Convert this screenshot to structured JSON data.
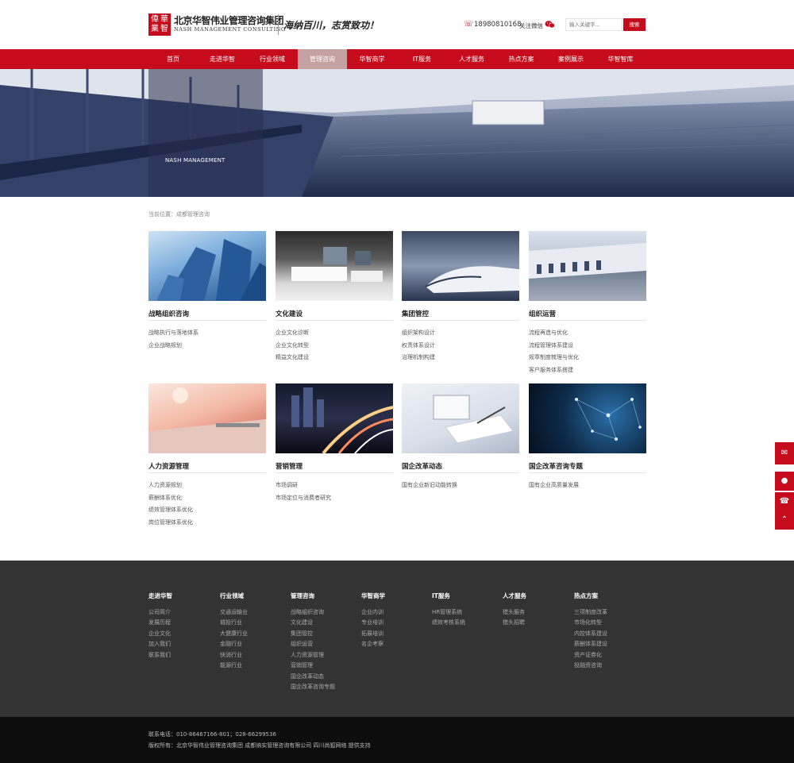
{
  "header": {
    "seal_chars": [
      "偉",
      "華",
      "業",
      "智"
    ],
    "logo_cn": "北京华智伟业管理咨询集团",
    "logo_en": "NASH MANAGEMENT CONSULTING",
    "slogan": "海纳百川，志赏致功！",
    "phone": "18980810168",
    "follow_label": "关注微信",
    "search_placeholder": "输入关键字...",
    "search_button": "搜索",
    "accent_color": "#c60c1c"
  },
  "nav": {
    "items": [
      "首页",
      "走进华智",
      "行业领域",
      "管理咨询",
      "华智商学",
      "IT服务",
      "人才服务",
      "热点方案",
      "案例展示",
      "华智智库"
    ],
    "active_index": 3
  },
  "banner": {
    "caption": "NASH MANAGEMENT"
  },
  "breadcrumb": "当前位置：成都管理咨询",
  "cards": [
    {
      "title": "战略组织咨询",
      "image": "glass-skyscraper-photo",
      "links": [
        "战略执行与落地体系",
        "企业战略规划"
      ]
    },
    {
      "title": "文化建设",
      "image": "modern-office-photo",
      "links": [
        "企业文化诊断",
        "企业文化转型",
        "精益文化建设"
      ]
    },
    {
      "title": "集团管控",
      "image": "high-speed-train-photo",
      "links": [
        "组织架构设计",
        "权责体系设计",
        "治理机制构建"
      ]
    },
    {
      "title": "组织运营",
      "image": "logistics-warehouse-photo",
      "links": [
        "流程再造与优化",
        "流程管理体系建设",
        "规章制度梳理与优化",
        "客户服务体系搭建"
      ]
    },
    {
      "title": "人力资源管理",
      "image": "desk-at-sunset-photo",
      "links": [
        "人力资源规划",
        "薪酬体系优化",
        "绩效管理体系优化",
        "岗位管理体系优化"
      ]
    },
    {
      "title": "营销管理",
      "image": "city-night-traffic-photo",
      "links": [
        "市场调研",
        "市场定位与消费者研究"
      ]
    },
    {
      "title": "国企改革动态",
      "image": "business-documents-photo",
      "links": [
        "国有企业新旧动能转换"
      ]
    },
    {
      "title": "国企改革咨询专题",
      "image": "network-nodes-photo",
      "links": [
        "国有企业高质量发展"
      ]
    }
  ],
  "footer": {
    "columns": [
      {
        "title": "走进华智",
        "items": [
          "公司简介",
          "发展历程",
          "企业文化",
          "加入我们",
          "联系我们"
        ]
      },
      {
        "title": "行业领域",
        "items": [
          "交通运输业",
          "城投行业",
          "大健康行业",
          "金融行业",
          "快消行业",
          "能源行业"
        ]
      },
      {
        "title": "管理咨询",
        "items": [
          "战略组织咨询",
          "文化建设",
          "集团管控",
          "组织运营",
          "人力资源管理",
          "营销管理",
          "国企改革动态",
          "国企改革咨询专题"
        ]
      },
      {
        "title": "华智商学",
        "items": [
          "企业内训",
          "专业培训",
          "拓展培训",
          "名企考察"
        ]
      },
      {
        "title": "IT服务",
        "items": [
          "HR管理系统",
          "绩效考核系统"
        ]
      },
      {
        "title": "人才服务",
        "items": [
          "猎头服务",
          "猎头招聘"
        ]
      },
      {
        "title": "热点方案",
        "items": [
          "三项制度改革",
          "市场化转型",
          "内控体系建设",
          "薪酬体系建设",
          "资产证券化",
          "投融资咨询"
        ]
      }
    ],
    "contact": "联系电话：010-86467166-801；028-66299536",
    "copyright": "版权所有：北京华智伟业管理咨询集团 成都纳实管理咨询有限公司  四川尚狐网络 提供支持"
  },
  "float_bar": {
    "icons": [
      "message-icon",
      "qq-icon",
      "phone-icon",
      "back-to-top-icon"
    ]
  }
}
